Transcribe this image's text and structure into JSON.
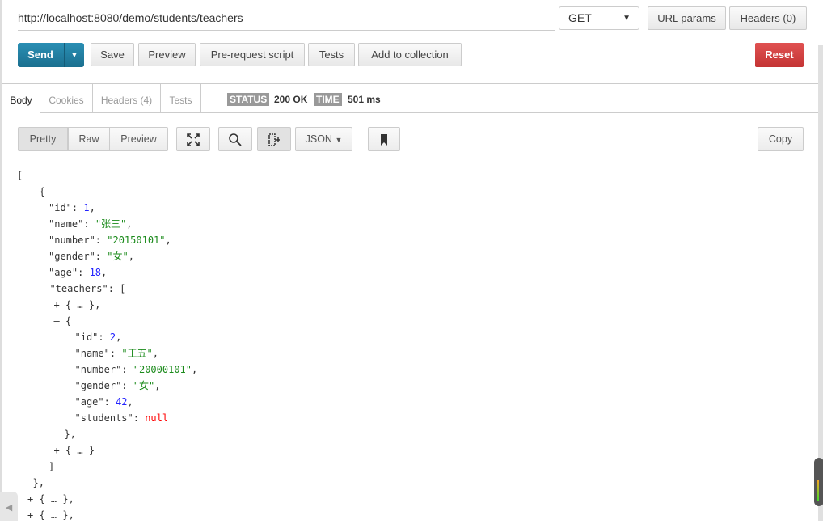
{
  "request": {
    "url": "http://localhost:8080/demo/students/teachers",
    "method": "GET",
    "url_params": "URL params",
    "headers": "Headers (0)"
  },
  "toolbar": {
    "send": "Send",
    "save": "Save",
    "preview": "Preview",
    "prerequest": "Pre-request script",
    "tests": "Tests",
    "add_collection": "Add to collection",
    "reset": "Reset"
  },
  "colors": {
    "send": "#1f7fa3",
    "reset": "#d64242",
    "string": "#1a8a1a",
    "number": "#2424ff",
    "null": "#ff0000"
  },
  "response_tabs": [
    {
      "label": "Body",
      "active": true
    },
    {
      "label": "Cookies"
    },
    {
      "label": "Headers (4)"
    },
    {
      "label": "Tests"
    }
  ],
  "status": {
    "status_label": "STATUS",
    "status_value": "200 OK",
    "time_label": "TIME",
    "time_value": "501 ms"
  },
  "view": {
    "pretty": "Pretty",
    "raw": "Raw",
    "preview": "Preview",
    "format": "JSON",
    "copy": "Copy",
    "icons": [
      "expand-icon",
      "search-icon",
      "wrap-icon",
      "bookmark-icon"
    ]
  },
  "scroll_indicator_level": 0.55,
  "json_lines": [
    {
      "d": 0,
      "seg": [
        [
          "p",
          "["
        ]
      ]
    },
    {
      "d": 1,
      "seg": [
        [
          "tg",
          "– "
        ],
        [
          "p",
          "{"
        ]
      ]
    },
    {
      "d": 3,
      "seg": [
        [
          "k",
          "\"id\""
        ],
        [
          "p",
          ": "
        ],
        [
          "n",
          "1"
        ],
        [
          "p",
          ","
        ]
      ]
    },
    {
      "d": 3,
      "seg": [
        [
          "k",
          "\"name\""
        ],
        [
          "p",
          ": "
        ],
        [
          "s",
          "\"张三\""
        ],
        [
          "p",
          ","
        ]
      ]
    },
    {
      "d": 3,
      "seg": [
        [
          "k",
          "\"number\""
        ],
        [
          "p",
          ": "
        ],
        [
          "s",
          "\"20150101\""
        ],
        [
          "p",
          ","
        ]
      ]
    },
    {
      "d": 3,
      "seg": [
        [
          "k",
          "\"gender\""
        ],
        [
          "p",
          ": "
        ],
        [
          "s",
          "\"女\""
        ],
        [
          "p",
          ","
        ]
      ]
    },
    {
      "d": 3,
      "seg": [
        [
          "k",
          "\"age\""
        ],
        [
          "p",
          ": "
        ],
        [
          "n",
          "18"
        ],
        [
          "p",
          ","
        ]
      ]
    },
    {
      "d": 2,
      "seg": [
        [
          "tg",
          "– "
        ],
        [
          "k",
          "\"teachers\""
        ],
        [
          "p",
          ": ["
        ]
      ]
    },
    {
      "d": 3.5,
      "seg": [
        [
          "tg",
          "+ "
        ],
        [
          "p",
          "{ … },"
        ]
      ]
    },
    {
      "d": 3.5,
      "seg": [
        [
          "tg",
          "– "
        ],
        [
          "p",
          "{"
        ]
      ]
    },
    {
      "d": 5.5,
      "seg": [
        [
          "k",
          "\"id\""
        ],
        [
          "p",
          ": "
        ],
        [
          "n",
          "2"
        ],
        [
          "p",
          ","
        ]
      ]
    },
    {
      "d": 5.5,
      "seg": [
        [
          "k",
          "\"name\""
        ],
        [
          "p",
          ": "
        ],
        [
          "s",
          "\"王五\""
        ],
        [
          "p",
          ","
        ]
      ]
    },
    {
      "d": 5.5,
      "seg": [
        [
          "k",
          "\"number\""
        ],
        [
          "p",
          ": "
        ],
        [
          "s",
          "\"20000101\""
        ],
        [
          "p",
          ","
        ]
      ]
    },
    {
      "d": 5.5,
      "seg": [
        [
          "k",
          "\"gender\""
        ],
        [
          "p",
          ": "
        ],
        [
          "s",
          "\"女\""
        ],
        [
          "p",
          ","
        ]
      ]
    },
    {
      "d": 5.5,
      "seg": [
        [
          "k",
          "\"age\""
        ],
        [
          "p",
          ": "
        ],
        [
          "n",
          "42"
        ],
        [
          "p",
          ","
        ]
      ]
    },
    {
      "d": 5.5,
      "seg": [
        [
          "k",
          "\"students\""
        ],
        [
          "p",
          ": "
        ],
        [
          "z",
          "null"
        ]
      ]
    },
    {
      "d": 4.5,
      "seg": [
        [
          "p",
          "},"
        ]
      ]
    },
    {
      "d": 3.5,
      "seg": [
        [
          "tg",
          "+ "
        ],
        [
          "p",
          "{ … }"
        ]
      ]
    },
    {
      "d": 3,
      "seg": [
        [
          "p",
          "]"
        ]
      ]
    },
    {
      "d": 1.5,
      "seg": [
        [
          "p",
          "},"
        ]
      ]
    },
    {
      "d": 1,
      "seg": [
        [
          "tg",
          "+ "
        ],
        [
          "p",
          "{ … },"
        ]
      ]
    },
    {
      "d": 1,
      "seg": [
        [
          "tg",
          "+ "
        ],
        [
          "p",
          "{ … },"
        ]
      ]
    }
  ]
}
